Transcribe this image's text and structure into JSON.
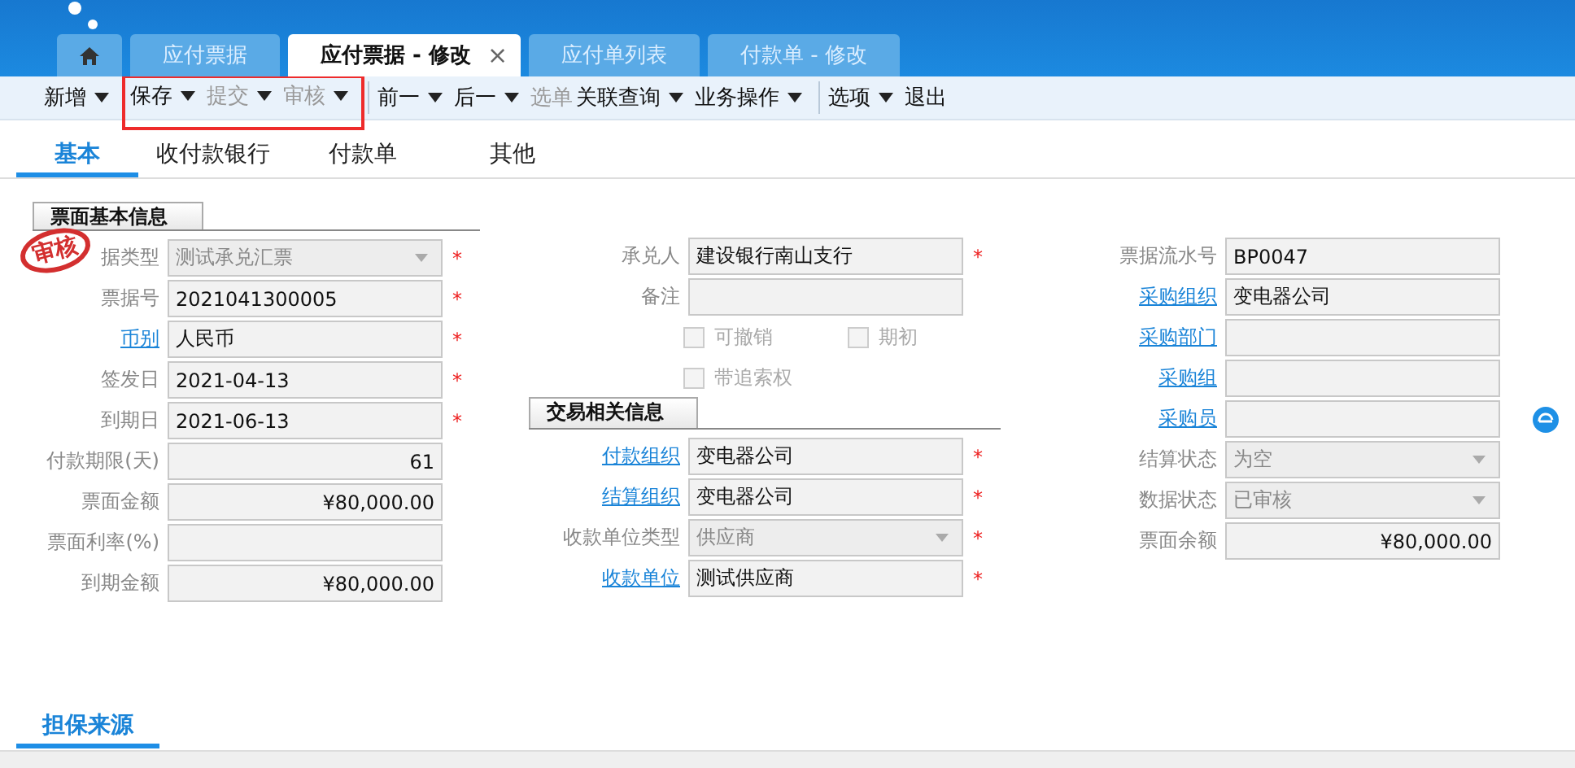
{
  "tabs": [
    {
      "kind": "home",
      "selected": false
    },
    {
      "kind": "page",
      "label": "应付票据",
      "selected": false
    },
    {
      "kind": "page",
      "label": "应付票据 - 修改",
      "selected": true,
      "close": "×"
    },
    {
      "kind": "page",
      "label": "应付单列表",
      "selected": false
    },
    {
      "kind": "page",
      "label": "付款单 - 修改",
      "selected": false
    }
  ],
  "toolbar": [
    {
      "divider": false,
      "highlighted": false,
      "items": [
        {
          "label": "新增",
          "disabled": false,
          "dropdown": true
        }
      ]
    },
    {
      "divider": false,
      "highlighted": true,
      "items": [
        {
          "label": "保存",
          "disabled": false,
          "dropdown": true
        },
        {
          "label": "提交",
          "disabled": true,
          "dropdown": true
        },
        {
          "label": "审核",
          "disabled": true,
          "dropdown": true
        }
      ]
    },
    {
      "divider": true,
      "highlighted": false,
      "items": [
        {
          "label": "前一",
          "disabled": false,
          "dropdown": true
        },
        {
          "label": "后一",
          "disabled": false,
          "dropdown": true
        },
        {
          "label": "选单",
          "disabled": true,
          "dropdown": false
        },
        {
          "label": "关联查询",
          "disabled": false,
          "dropdown": true
        },
        {
          "label": "业务操作",
          "disabled": false,
          "dropdown": true
        }
      ]
    },
    {
      "divider": true,
      "highlighted": false,
      "items": [
        {
          "label": "选项",
          "disabled": false,
          "dropdown": true
        },
        {
          "label": "退出",
          "disabled": false,
          "dropdown": false
        }
      ]
    }
  ],
  "form_tabs": [
    {
      "label": "基本",
      "selected": true
    },
    {
      "label": "收付款银行",
      "selected": false
    },
    {
      "label": "付款单",
      "selected": false
    },
    {
      "label": "其他",
      "selected": false
    }
  ],
  "section_basic": {
    "title": "票面基本信息",
    "stamp": "审核"
  },
  "column_1": [
    {
      "kind": "dropdown",
      "stamped": true,
      "label": "据类型",
      "value": "测试承兑汇票",
      "disabled": true,
      "required": "*"
    },
    {
      "kind": "text",
      "label": "票据号",
      "link": false,
      "value": "2021041300005",
      "disabled": false,
      "required": "*"
    },
    {
      "kind": "text",
      "label": "币别",
      "link": true,
      "value": "人民币",
      "disabled": false,
      "required": "*"
    },
    {
      "kind": "text",
      "label": "签发日",
      "link": false,
      "value": "2021-04-13",
      "disabled": false,
      "required": "*"
    },
    {
      "kind": "text",
      "label": "到期日",
      "link": false,
      "value": "2021-06-13",
      "disabled": false,
      "required": "*"
    },
    {
      "kind": "number",
      "label": "付款期限(天)",
      "link": false,
      "value": "61",
      "disabled": false
    },
    {
      "kind": "number",
      "label": "票面金额",
      "link": false,
      "value": "¥80,000.00",
      "disabled": false
    },
    {
      "kind": "number",
      "label": "票面利率(%)",
      "link": false
    },
    {
      "kind": "number",
      "label": "到期金额",
      "link": false,
      "value": "¥80,000.00",
      "disabled": false
    }
  ],
  "column_2": [
    {
      "kind": "text",
      "label": "承兑人",
      "link": false,
      "value": "建设银行南山支行",
      "disabled": false,
      "required": "*"
    },
    {
      "kind": "text",
      "label": "备注",
      "link": false
    },
    {
      "kind": "checks",
      "items": [
        {
          "label": "可撤销",
          "checked": false
        },
        {
          "label": "期初",
          "checked": false
        }
      ]
    },
    {
      "kind": "checks",
      "items": [
        {
          "label": "带追索权",
          "checked": false
        }
      ]
    },
    {
      "kind": "section",
      "title": "交易相关信息"
    },
    {
      "kind": "text",
      "label": "付款组织",
      "link": true,
      "value": "变电器公司",
      "disabled": false,
      "required": "*"
    },
    {
      "kind": "text",
      "label": "结算组织",
      "link": true,
      "value": "变电器公司",
      "disabled": false,
      "required": "*"
    },
    {
      "kind": "dropdown",
      "label": "收款单位类型",
      "link": false,
      "value": "供应商",
      "disabled": true,
      "required": "*"
    },
    {
      "kind": "text",
      "label": "收款单位",
      "link": true,
      "value": "测试供应商",
      "disabled": false,
      "required": "*"
    }
  ],
  "column_3": [
    {
      "kind": "text",
      "label": "票据流水号",
      "link": false,
      "value": "BP0047",
      "disabled": false
    },
    {
      "kind": "text",
      "label": "采购组织",
      "link": true,
      "value": "变电器公司",
      "disabled": false
    },
    {
      "kind": "text",
      "label": "采购部门",
      "link": true
    },
    {
      "kind": "text",
      "label": "采购组",
      "link": true
    },
    {
      "kind": "text",
      "label": "采购员",
      "link": true,
      "action": true
    },
    {
      "kind": "dropdown",
      "label": "结算状态",
      "link": false,
      "value": "为空",
      "disabled": true
    },
    {
      "kind": "dropdown",
      "label": "数据状态",
      "link": false,
      "value": "已审核",
      "disabled": true
    },
    {
      "kind": "number",
      "label": "票面余额",
      "link": false,
      "value": "¥80,000.00",
      "disabled": false
    }
  ],
  "bottom_tabs": [
    {
      "label": "担保来源",
      "selected": true
    }
  ]
}
